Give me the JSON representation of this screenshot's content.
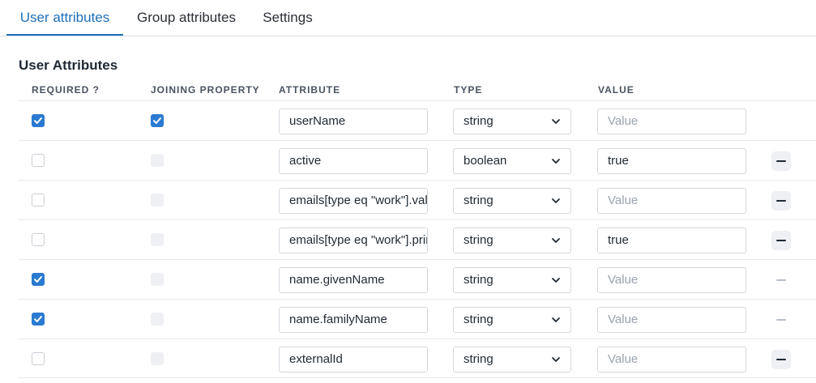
{
  "tabs": [
    {
      "label": "User attributes",
      "active": true
    },
    {
      "label": "Group attributes",
      "active": false
    },
    {
      "label": "Settings",
      "active": false
    }
  ],
  "section_title": "User Attributes",
  "columns": {
    "required": "REQUIRED ?",
    "joining": "JOINING PROPERTY",
    "attribute": "ATTRIBUTE",
    "type": "TYPE",
    "value": "VALUE"
  },
  "value_placeholder": "Value",
  "icons": {
    "check": "checkmark-icon",
    "dropdown": "chevron-down-icon",
    "remove": "minus-icon"
  },
  "colors": {
    "accent": "#1f6fb8",
    "checkbox_checked": "#2a7ad1"
  },
  "rows": [
    {
      "required": true,
      "joining": true,
      "joining_disabled": false,
      "attribute": "userName",
      "type": "string",
      "value": "",
      "remove": "none"
    },
    {
      "required": false,
      "joining": false,
      "joining_disabled": true,
      "attribute": "active",
      "type": "boolean",
      "value": "true",
      "remove": "enabled"
    },
    {
      "required": false,
      "joining": false,
      "joining_disabled": true,
      "attribute": "emails[type eq \"work\"].value",
      "type": "string",
      "value": "",
      "remove": "enabled"
    },
    {
      "required": false,
      "joining": false,
      "joining_disabled": true,
      "attribute": "emails[type eq \"work\"].primary",
      "type": "string",
      "value": "true",
      "remove": "enabled"
    },
    {
      "required": true,
      "joining": false,
      "joining_disabled": true,
      "attribute": "name.givenName",
      "type": "string",
      "value": "",
      "remove": "disabled"
    },
    {
      "required": true,
      "joining": false,
      "joining_disabled": true,
      "attribute": "name.familyName",
      "type": "string",
      "value": "",
      "remove": "disabled"
    },
    {
      "required": false,
      "joining": false,
      "joining_disabled": true,
      "attribute": "externalId",
      "type": "string",
      "value": "",
      "remove": "enabled"
    }
  ]
}
